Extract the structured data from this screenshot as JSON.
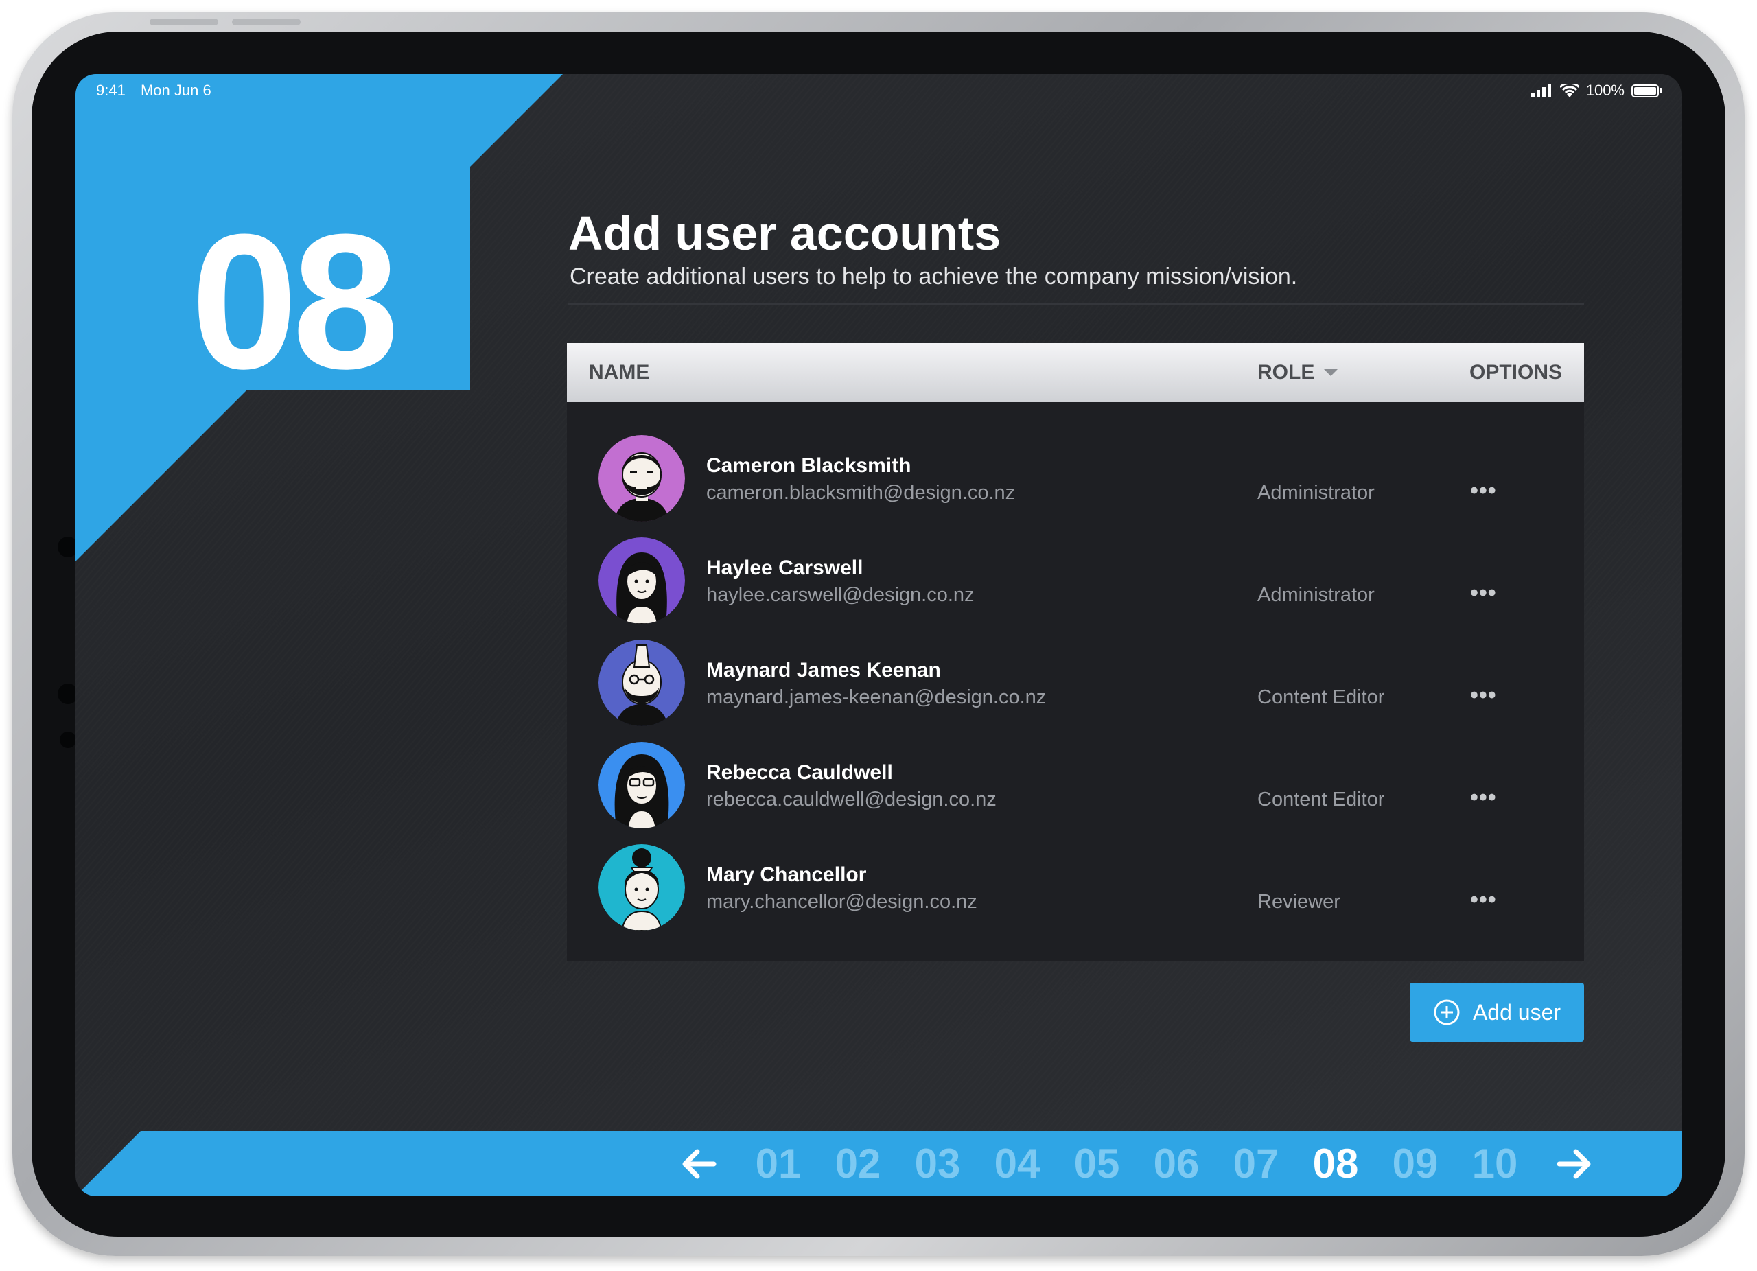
{
  "status_bar": {
    "time": "9:41",
    "date": "Mon Jun 6",
    "battery": "100%"
  },
  "step": {
    "number": "08"
  },
  "header": {
    "title": "Add user accounts",
    "subtitle": "Create additional users to help to achieve the company mission/vision."
  },
  "table": {
    "columns": {
      "name": "NAME",
      "role": "ROLE",
      "options": "OPTIONS"
    },
    "users": [
      {
        "name": "Cameron Blacksmith",
        "email": "cameron.blacksmith@design.co.nz",
        "role": "Administrator",
        "options": "•••",
        "avatar_color": "#c26fd1"
      },
      {
        "name": "Haylee Carswell",
        "email": "haylee.carswell@design.co.nz",
        "role": "Administrator",
        "options": "•••",
        "avatar_color": "#7a4fd0"
      },
      {
        "name": "Maynard James Keenan",
        "email": "maynard.james-keenan@design.co.nz",
        "role": "Content Editor",
        "options": "•••",
        "avatar_color": "#5663c8"
      },
      {
        "name": "Rebecca Cauldwell",
        "email": "rebecca.cauldwell@design.co.nz",
        "role": "Content Editor",
        "options": "•••",
        "avatar_color": "#3a8ff0"
      },
      {
        "name": "Mary Chancellor",
        "email": "mary.chancellor@design.co.nz",
        "role": "Reviewer",
        "options": "•••",
        "avatar_color": "#1fb6cf"
      }
    ]
  },
  "add_user_button": {
    "label": "Add user",
    "icon": "plus-circle-icon"
  },
  "pagination": {
    "pages": [
      "01",
      "02",
      "03",
      "04",
      "05",
      "06",
      "07",
      "08",
      "09",
      "10"
    ],
    "current": "08",
    "prev_icon": "arrow-left-icon",
    "next_icon": "arrow-right-icon"
  },
  "colors": {
    "accent": "#2fa5e5",
    "background": "#27292d",
    "table_bg": "#1e1f23"
  }
}
